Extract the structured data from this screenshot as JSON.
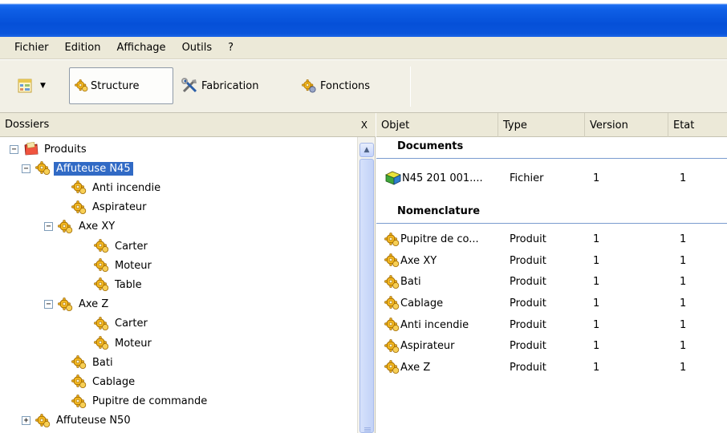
{
  "menu": [
    "Fichier",
    "Edition",
    "Affichage",
    "Outils",
    "?"
  ],
  "toolbar": {
    "structure_label": "Structure",
    "fabrication_label": "Fabrication",
    "fonctions_label": "Fonctions"
  },
  "left_pane": {
    "header": "Dossiers",
    "close_label": "X",
    "tree": [
      {
        "label": "Produits",
        "expander": "−",
        "icon": "folder-icon",
        "depth": 0
      },
      {
        "label": "Affuteuse N45",
        "expander": "−",
        "icon": "gear-icon",
        "depth": 1,
        "selected": true
      },
      {
        "label": "Anti incendie",
        "icon": "gear-icon",
        "depth": 2
      },
      {
        "label": "Aspirateur",
        "icon": "gear-icon",
        "depth": 2
      },
      {
        "label": "Axe XY",
        "expander": "−",
        "icon": "gear-icon",
        "depth": 2
      },
      {
        "label": "Carter",
        "icon": "gear-icon",
        "depth": 3
      },
      {
        "label": "Moteur",
        "icon": "gear-icon",
        "depth": 3
      },
      {
        "label": "Table",
        "icon": "gear-icon",
        "depth": 3
      },
      {
        "label": "Axe Z",
        "expander": "−",
        "icon": "gear-icon",
        "depth": 2
      },
      {
        "label": "Carter",
        "icon": "gear-icon",
        "depth": 3
      },
      {
        "label": "Moteur",
        "icon": "gear-icon",
        "depth": 3
      },
      {
        "label": "Bati",
        "icon": "gear-icon",
        "depth": 2
      },
      {
        "label": "Cablage",
        "icon": "gear-icon",
        "depth": 2
      },
      {
        "label": "Pupitre de commande",
        "icon": "gear-icon",
        "depth": 2
      },
      {
        "label": "Affuteuse N50",
        "expander": "+",
        "icon": "gear-icon",
        "depth": 1
      }
    ]
  },
  "right_pane": {
    "columns": [
      "Objet",
      "Type",
      "Version",
      "Etat"
    ],
    "groups": [
      {
        "title": "Documents",
        "rows": [
          {
            "objet": "N45 201 001....",
            "type": "Fichier",
            "version": "1",
            "etat": "1",
            "icon": "document-icon"
          }
        ]
      },
      {
        "title": "Nomenclature",
        "rows": [
          {
            "objet": "Pupitre de co...",
            "type": "Produit",
            "version": "1",
            "etat": "1",
            "icon": "gear-icon"
          },
          {
            "objet": "Axe XY",
            "type": "Produit",
            "version": "1",
            "etat": "1",
            "icon": "gear-icon"
          },
          {
            "objet": "Bati",
            "type": "Produit",
            "version": "1",
            "etat": "1",
            "icon": "gear-icon"
          },
          {
            "objet": "Cablage",
            "type": "Produit",
            "version": "1",
            "etat": "1",
            "icon": "gear-icon"
          },
          {
            "objet": "Anti incendie",
            "type": "Produit",
            "version": "1",
            "etat": "1",
            "icon": "gear-icon"
          },
          {
            "objet": "Aspirateur",
            "type": "Produit",
            "version": "1",
            "etat": "1",
            "icon": "gear-icon"
          },
          {
            "objet": "Axe Z",
            "type": "Produit",
            "version": "1",
            "etat": "1",
            "icon": "gear-icon"
          }
        ]
      }
    ]
  },
  "colors": {
    "titlebar": "#0550d8",
    "selection": "#316ac5",
    "chrome": "#ece9d8",
    "gear": "#f2b61e"
  }
}
